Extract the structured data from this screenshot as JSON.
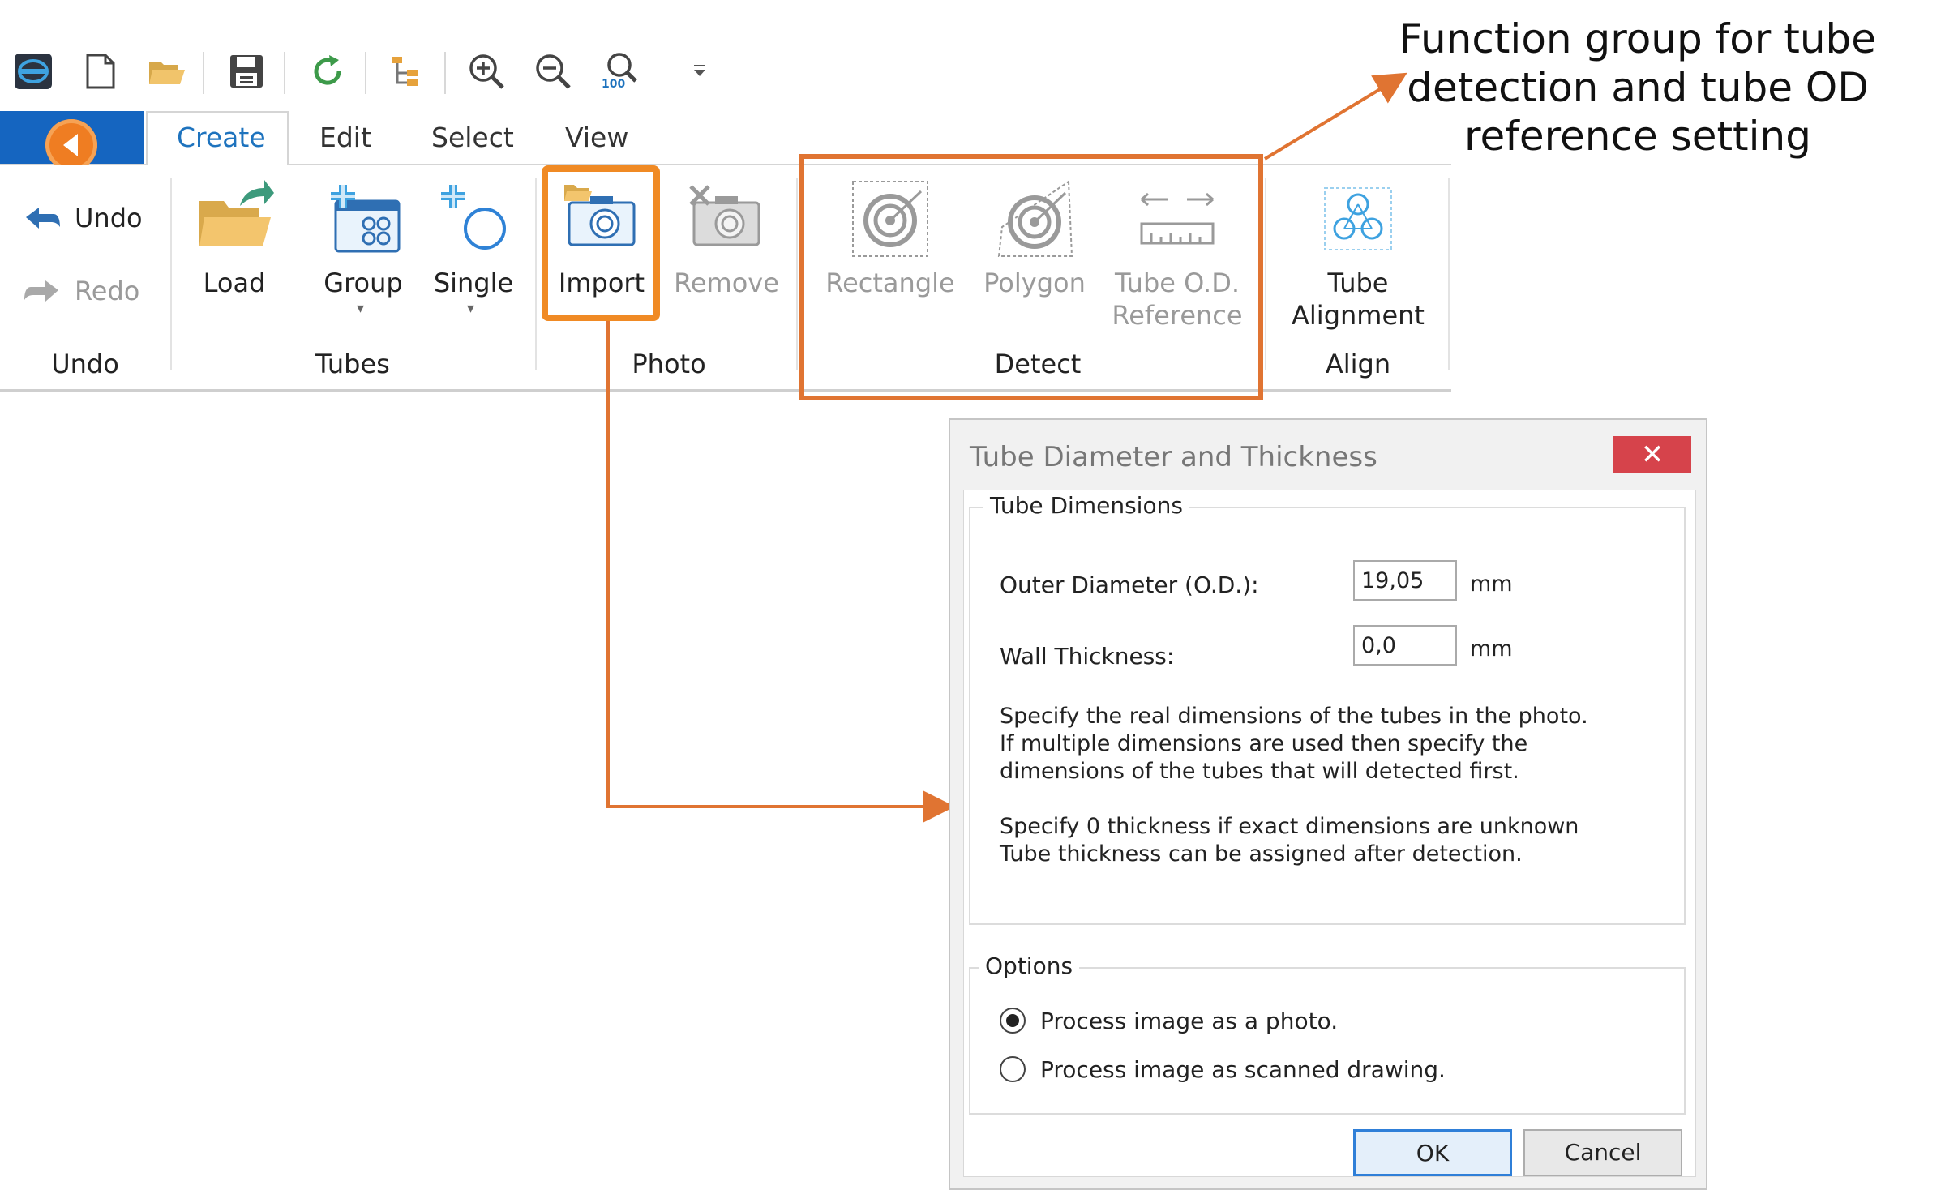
{
  "qat": {
    "icons": [
      "app-logo-icon",
      "new-file-icon",
      "open-folder-icon",
      "save-icon",
      "refresh-icon",
      "tree-view-icon",
      "zoom-in-icon",
      "zoom-out-icon",
      "zoom-100-icon",
      "customize-dropdown-icon"
    ],
    "zoom100_text": "100"
  },
  "tabs": [
    {
      "label": "Create",
      "active": true
    },
    {
      "label": "Edit"
    },
    {
      "label": "Select"
    },
    {
      "label": "View"
    }
  ],
  "ribbon": {
    "undo": {
      "undo_label": "Undo",
      "redo_label": "Redo",
      "group_label": "Undo"
    },
    "tubes": {
      "load_label": "Load",
      "group_btn_label": "Group",
      "single_label": "Single",
      "group_label": "Tubes"
    },
    "photo": {
      "import_label": "Import",
      "remove_label": "Remove",
      "group_label": "Photo"
    },
    "detect": {
      "rectangle_label": "Rectangle",
      "polygon_label": "Polygon",
      "tube_od_line1": "Tube O.D.",
      "tube_od_line2": "Reference",
      "group_label": "Detect"
    },
    "align": {
      "tube_alignment_line1": "Tube",
      "tube_alignment_line2": "Alignment",
      "group_label": "Align"
    }
  },
  "callout": {
    "text": "Function group for tube detection and tube OD reference setting",
    "color": "#e07432"
  },
  "dialog": {
    "title": "Tube Diameter and Thickness",
    "close_glyph": "✕",
    "dimensions": {
      "legend": "Tube Dimensions",
      "outer_label": "Outer Diameter (O.D.):",
      "outer_value": "19,05",
      "outer_unit": "mm",
      "wall_label": "Wall Thickness:",
      "wall_value": "0,0",
      "wall_unit": "mm",
      "para1": "Specify the real dimensions of the tubes in the photo.\nIf multiple dimensions are used then specify the\ndimensions of the tubes that will detected first.",
      "para2": "Specify 0 thickness if exact dimensions are unknown\nTube thickness can be assigned after detection."
    },
    "options": {
      "legend": "Options",
      "radio1": {
        "label": "Process image as a photo.",
        "checked": true
      },
      "radio2": {
        "label": "Process image as scanned drawing.",
        "checked": false
      }
    },
    "ok_label": "OK",
    "cancel_label": "Cancel"
  }
}
